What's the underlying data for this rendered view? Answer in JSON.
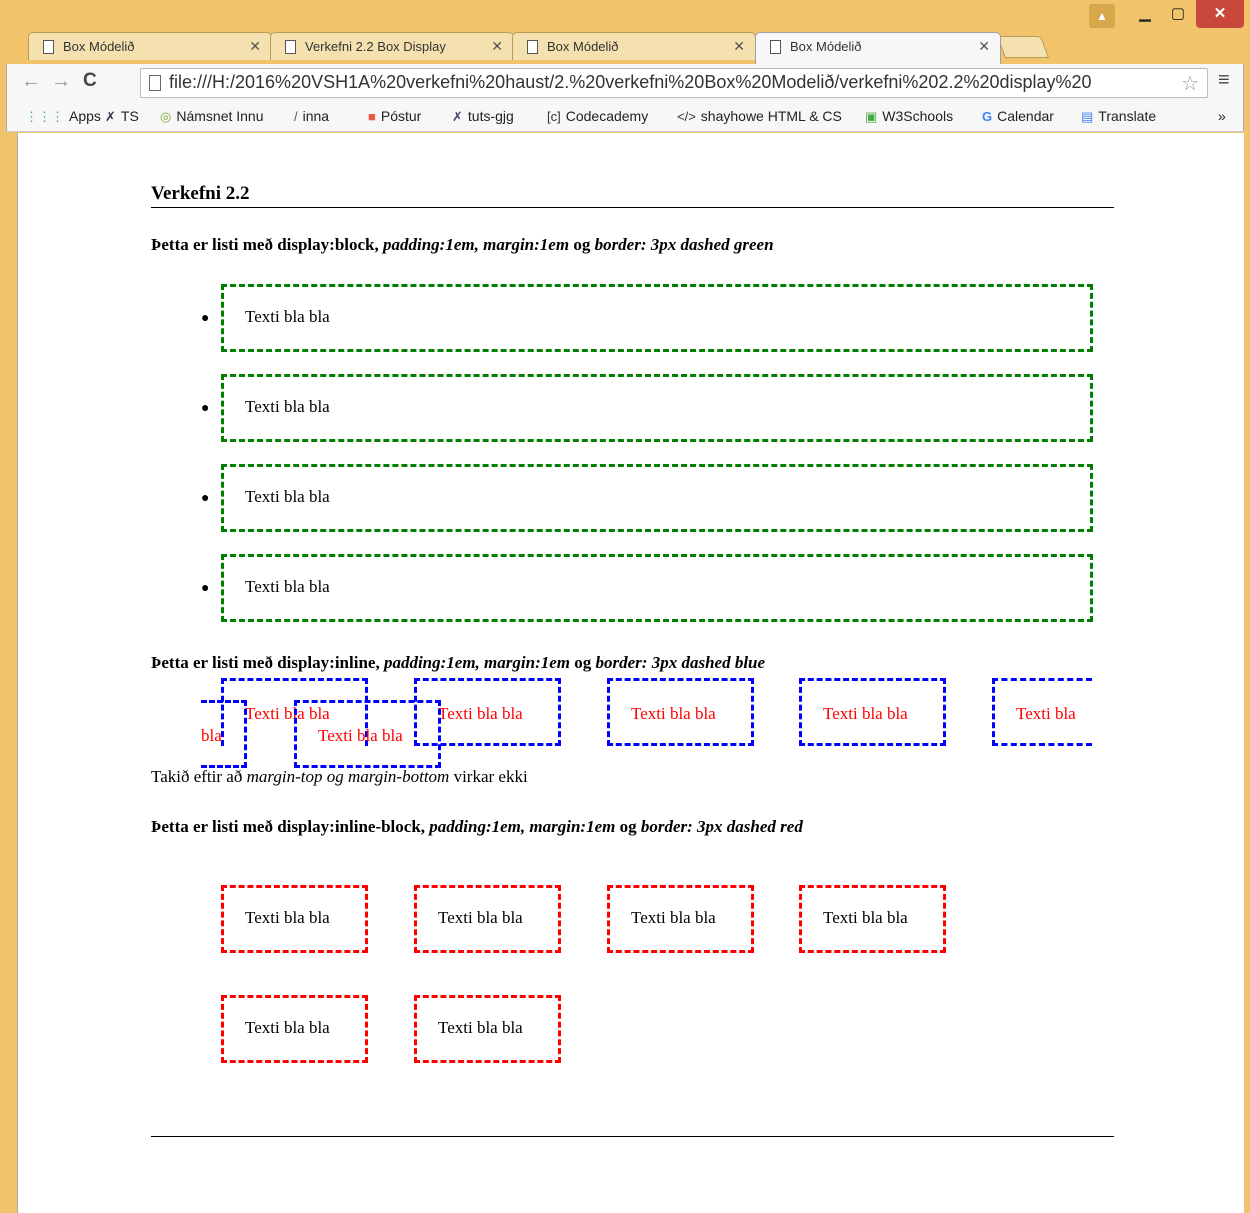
{
  "browser": {
    "tabs": [
      {
        "title": "Box Módelið"
      },
      {
        "title": "Verkefni 2.2 Box Display"
      },
      {
        "title": "Box Módelið"
      },
      {
        "title": "Box Módelið"
      }
    ],
    "url": "file:///H:/2016%20VSH1A%20verkefni%20haust/2.%20verkefni%20Box%20Modelið/verkefni%202.2%20display%20",
    "bookmarks": [
      "Apps",
      "TS",
      "Námsnet Innu",
      "inna",
      "Póstur",
      "tuts-gjg",
      "Codecademy",
      "shayhowe HTML & CS",
      "W3Schools",
      "Calendar",
      "Translate"
    ],
    "overflow": "»"
  },
  "content": {
    "heading": "Verkefni 2.2",
    "block_intro": {
      "bold": "Þetta er listi með display:block, ",
      "italic": "padding:1em, margin:1em",
      "og": " og ",
      "italic2": "border: 3px dashed green"
    },
    "block_items": [
      "Texti bla bla",
      "Texti bla bla",
      "Texti bla bla",
      "Texti bla bla"
    ],
    "inline_intro": {
      "bold": "Þetta er listi með display:inline, ",
      "italic": "padding:1em, margin:1em",
      "og": " og ",
      "italic2": "border: 3px dashed blue"
    },
    "inline_items": [
      "Texti bla bla",
      "Texti bla bla",
      "Texti bla bla",
      "Texti bla bla",
      "Texti bla",
      "bla",
      "Texti bla bla"
    ],
    "note": {
      "pre": "Takið eftir að ",
      "italic": "margin-top og margin-bottom",
      "post": " virkar ekki"
    },
    "inlineblock_intro": {
      "bold": "Þetta er listi með display:inline-block, ",
      "italic": "padding:1em, margin:1em",
      "og": " og ",
      "italic2": "border: 3px dashed red"
    },
    "inlineblock_items": [
      "Texti bla bla",
      "Texti bla bla",
      "Texti bla bla",
      "Texti bla bla",
      "Texti bla bla",
      "Texti bla bla"
    ]
  }
}
